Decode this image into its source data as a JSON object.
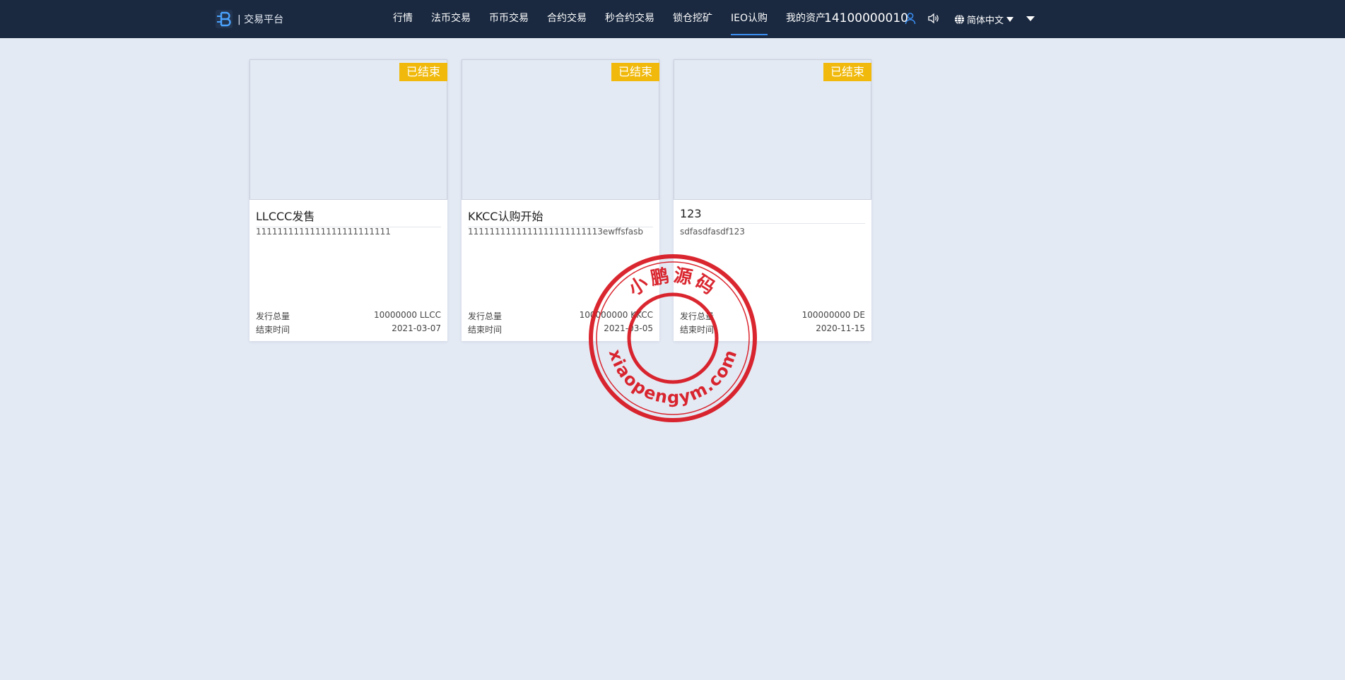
{
  "header": {
    "brand_text": "| 交易平台",
    "nav": [
      {
        "label": "行情",
        "active": false
      },
      {
        "label": "法币交易",
        "active": false
      },
      {
        "label": "币币交易",
        "active": false
      },
      {
        "label": "合约交易",
        "active": false
      },
      {
        "label": "秒合约交易",
        "active": false
      },
      {
        "label": "锁仓挖矿",
        "active": false
      },
      {
        "label": "IEO认购",
        "active": true
      },
      {
        "label": "我的资产",
        "active": false
      }
    ],
    "account": "14100000010",
    "language": "简体中文",
    "icons": {
      "logo": "brand-b-logo-icon",
      "user": "user-icon",
      "sound": "speaker-icon",
      "language": "globe-icon",
      "more": "caret-down-icon"
    },
    "colors": {
      "background": "#1a2940",
      "active_underline": "#3b8ff3",
      "user_icon": "#3b8ff3"
    }
  },
  "cards": [
    {
      "status": "已结束",
      "title": "LLCCC发售",
      "desc": "1111111111111111111111111",
      "issue_label": "发行总量",
      "issue_value": "10000000 LLCC",
      "end_label": "结束时间",
      "end_value": "2021-03-07"
    },
    {
      "status": "已结束",
      "title": "KKCC认购开始",
      "desc": "1111111111111111111111113ewffsfasb",
      "issue_label": "发行总量",
      "issue_value": "100000000 KKCC",
      "end_label": "结束时间",
      "end_value": "2021-03-05"
    },
    {
      "status": "已结束",
      "title": "123",
      "desc": "sdfasdfasdf123",
      "issue_label": "发行总量",
      "issue_value": "100000000 DE",
      "end_label": "结束时间",
      "end_value": "2020-11-15"
    }
  ],
  "watermark": {
    "top_text": "小鹏源码",
    "bottom_text": "xiaopengym.com",
    "color": "#d7141e"
  },
  "colors": {
    "page_background": "#e4eaf4",
    "badge": "#f0b90b"
  }
}
